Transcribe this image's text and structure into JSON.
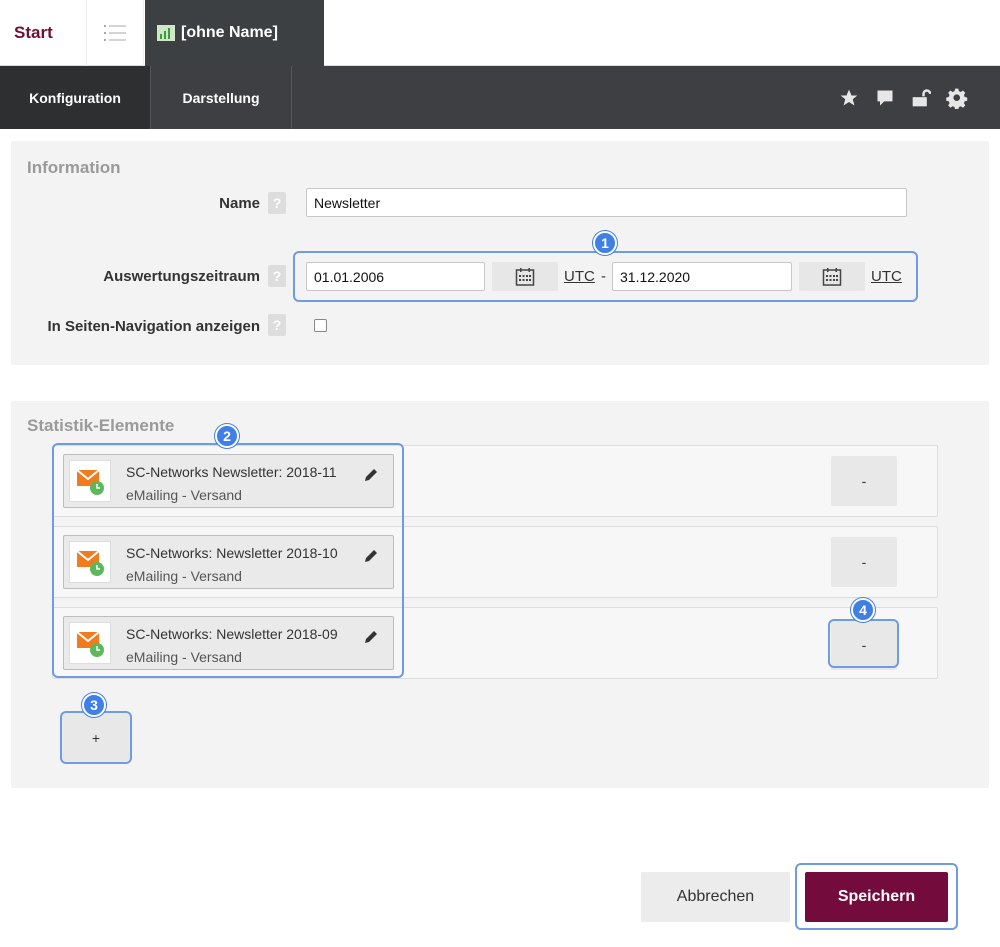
{
  "tabs": {
    "start_label": "Start",
    "doc_label": "[ohne Name]"
  },
  "nav": {
    "tabs": [
      {
        "label": "Konfiguration"
      },
      {
        "label": "Darstellung"
      }
    ],
    "icons": [
      "star-icon",
      "comment-icon",
      "unlock-icon",
      "gear-icon"
    ]
  },
  "info": {
    "title": "Information",
    "name_label": "Name",
    "name_value": "Newsletter",
    "period_label": "Auswertungszeitraum",
    "date_from": "01.01.2006",
    "date_to": "31.12.2020",
    "tz_from": "UTC",
    "tz_to": "UTC",
    "separator": "-",
    "nav_label": "In Seiten-Navigation anzeigen",
    "help": "?"
  },
  "stats": {
    "title": "Statistik-Elemente",
    "items": [
      {
        "title": "SC-Networks Newsletter: 2018-11",
        "subtitle": "eMailing - Versand",
        "remove": "-"
      },
      {
        "title": "SC-Networks: Newsletter 2018-10",
        "subtitle": "eMailing - Versand",
        "remove": "-"
      },
      {
        "title": "SC-Networks: Newsletter 2018-09",
        "subtitle": "eMailing - Versand",
        "remove": "-"
      }
    ],
    "add": "+"
  },
  "badges": [
    "1",
    "2",
    "3",
    "4"
  ],
  "buttons": {
    "cancel": "Abbrechen",
    "save": "Speichern"
  },
  "colors": {
    "brand": "#730b3c",
    "highlight": "#3f7fe6",
    "nav_dark": "#3d3f42"
  }
}
